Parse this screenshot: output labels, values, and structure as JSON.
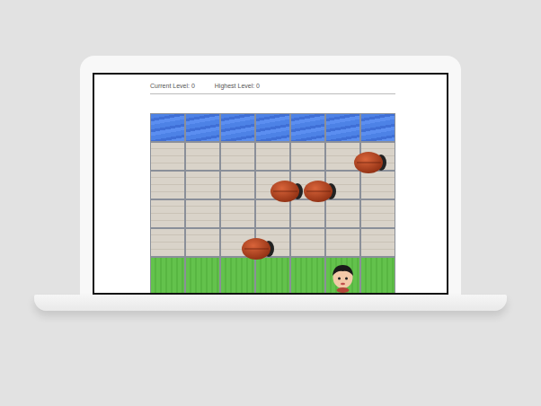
{
  "header": {
    "current_level": "Current Level: 0",
    "highest_level": "Highest Level: 0"
  },
  "board": {
    "columns": 7,
    "rows": [
      "water",
      "stone",
      "stone",
      "stone",
      "stone",
      "grass"
    ]
  },
  "enemies": [
    {
      "row": 1,
      "col": 5.8
    },
    {
      "row": 2,
      "col": 3.4
    },
    {
      "row": 2,
      "col": 4.35
    },
    {
      "row": 4,
      "col": 2.6
    }
  ],
  "player": {
    "row": 5,
    "col": 5
  }
}
